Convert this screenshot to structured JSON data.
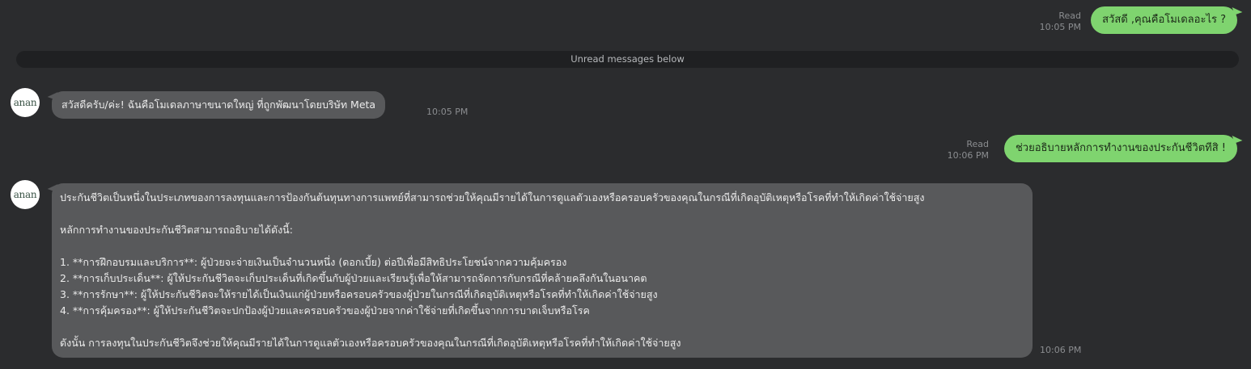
{
  "messages": [
    {
      "id": "m1",
      "direction": "outgoing",
      "status": "Read",
      "time": "10:05 PM",
      "text": "สวัสดี ,คุณคือโมเดลอะไร ?"
    },
    {
      "id": "m2",
      "direction": "incoming",
      "avatar_text": "anan",
      "time": "10:05 PM",
      "text": "สวัสดีครับ/ค่ะ! ฉันคือโมเดลภาษาขนาดใหญ่ ที่ถูกพัฒนาโดยบริษัท Meta"
    },
    {
      "id": "m3",
      "direction": "outgoing",
      "status": "Read",
      "time": "10:06 PM",
      "text": "ช่วยอธิบายหลักการทำงานของประกันชีวิตทีสิ !"
    },
    {
      "id": "m4",
      "direction": "incoming",
      "avatar_text": "anan",
      "time": "10:06 PM",
      "intro": "ประกันชีวิตเป็นหนึ่งในประเภทของการลงทุนและการป้องกันต้นทุนทางการแพทย์ที่สามารถช่วยให้คุณมีรายได้ในการดูแลตัวเองหรือครอบครัวของคุณในกรณีที่เกิดอุบัติเหตุหรือโรคที่ทำให้เกิดค่าใช้จ่ายสูง",
      "heading": "หลักการทำงานของประกันชีวิตสามารถอธิบายได้ดังนี้:",
      "items": [
        "1. **การฝึกอบรมและบริการ**: ผู้ป่วยจะจ่ายเงินเป็นจำนวนหนึ่ง (ดอกเบี้ย) ต่อปีเพื่อมีสิทธิประโยชน์จากความคุ้มครอง",
        "2. **การเก็บประเด็น**: ผู้ให้ประกันชีวิตจะเก็บประเด็นที่เกิดขึ้นกับผู้ป่วยและเรียนรู้เพื่อให้สามารถจัดการกับกรณีที่คล้ายคลึงกันในอนาคต",
        "3. **การรักษา**: ผู้ให้ประกันชีวิตจะให้รายได้เป็นเงินแก่ผู้ป่วยหรือครอบครัวของผู้ป่วยในกรณีที่เกิดอุบัติเหตุหรือโรคที่ทำให้เกิดค่าใช้จ่ายสูง",
        "4. **การคุ้มครอง**: ผู้ให้ประกันชีวิตจะปกป้องผู้ป่วยและครอบครัวของผู้ป่วยจากค่าใช้จ่ายที่เกิดขึ้นจากการบาดเจ็บหรือโรค"
      ],
      "conclusion": "ดังนั้น การลงทุนในประกันชีวิตจึงช่วยให้คุณมีรายได้ในการดูแลตัวเองหรือครอบครัวของคุณในกรณีที่เกิดอุบัติเหตุหรือโรคที่ทำให้เกิดค่าใช้จ่ายสูง"
    }
  ],
  "divider": {
    "label": "Unread messages below"
  },
  "colors": {
    "background": "#2b2c2e",
    "outgoing_bubble": "#7fd46f",
    "incoming_bubble": "#58595b",
    "divider_bar": "#1f2022",
    "meta_text": "#8b8d90"
  }
}
